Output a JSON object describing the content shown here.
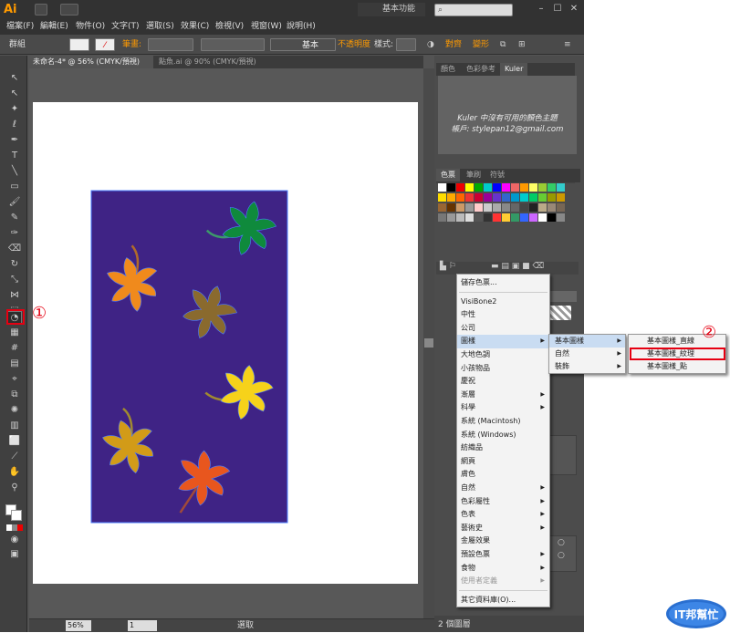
{
  "app": {
    "logo_text": "Ai",
    "workspace": "基本功能",
    "window_buttons": [
      "–",
      "☐",
      "✕"
    ]
  },
  "menubar": {
    "items": [
      "檔案(F)",
      "編輯(E)",
      "物件(O)",
      "文字(T)",
      "選取(S)",
      "效果(C)",
      "檢視(V)",
      "視窗(W)",
      "說明(H)"
    ]
  },
  "controlbar": {
    "selection_label": "群組",
    "stroke_label": "筆畫:",
    "stroke_style": "基本",
    "opacity_label": "不透明度",
    "style_label": "樣式:",
    "align_label": "對齊",
    "transform_label": "變形"
  },
  "doc_tabs": [
    {
      "label": "未命名-4* @ 56% (CMYK/預視)",
      "active": true
    },
    {
      "label": "點魚.ai @ 90% (CMYK/預視)",
      "active": false
    }
  ],
  "status": {
    "zoom": "56%",
    "page": "1",
    "mode": "選取"
  },
  "panels": {
    "top_tabs": [
      "顏色",
      "色彩參考",
      "Kuler"
    ],
    "kuler_message": "Kuler 中沒有可用的顏色主題",
    "kuler_account": "帳戶: stylepan12@gmail.com",
    "swatch_tabs": [
      "色票",
      "筆刷",
      "符號"
    ],
    "layers_label": "2 個圖層"
  },
  "context_menu": {
    "items": [
      {
        "label": "儲存色票...",
        "submenu": false,
        "highlight": false,
        "disabled": false
      },
      {
        "sep": true
      },
      {
        "label": "VisiBone2",
        "submenu": false,
        "highlight": false,
        "disabled": false
      },
      {
        "label": "中性",
        "submenu": false,
        "highlight": false,
        "disabled": false
      },
      {
        "label": "公司",
        "submenu": false,
        "highlight": false,
        "disabled": false
      },
      {
        "label": "圖樣",
        "submenu": true,
        "highlight": true,
        "disabled": false
      },
      {
        "label": "大地色調",
        "submenu": false,
        "highlight": false,
        "disabled": false
      },
      {
        "label": "小孩物品",
        "submenu": false,
        "highlight": false,
        "disabled": false
      },
      {
        "label": "慶祝",
        "submenu": false,
        "highlight": false,
        "disabled": false
      },
      {
        "label": "漸層",
        "submenu": true,
        "highlight": false,
        "disabled": false
      },
      {
        "label": "科學",
        "submenu": true,
        "highlight": false,
        "disabled": false
      },
      {
        "label": "系統 (Macintosh)",
        "submenu": false,
        "highlight": false,
        "disabled": false
      },
      {
        "label": "系統 (Windows)",
        "submenu": false,
        "highlight": false,
        "disabled": false
      },
      {
        "label": "紡織品",
        "submenu": false,
        "highlight": false,
        "disabled": false
      },
      {
        "label": "網頁",
        "submenu": false,
        "highlight": false,
        "disabled": false
      },
      {
        "label": "膚色",
        "submenu": false,
        "highlight": false,
        "disabled": false
      },
      {
        "label": "自然",
        "submenu": true,
        "highlight": false,
        "disabled": false
      },
      {
        "label": "色彩屬性",
        "submenu": true,
        "highlight": false,
        "disabled": false
      },
      {
        "label": "色表",
        "submenu": true,
        "highlight": false,
        "disabled": false
      },
      {
        "label": "藝術史",
        "submenu": true,
        "highlight": false,
        "disabled": false
      },
      {
        "label": "金屬效果",
        "submenu": false,
        "highlight": false,
        "disabled": false
      },
      {
        "label": "預設色票",
        "submenu": true,
        "highlight": false,
        "disabled": false
      },
      {
        "label": "食物",
        "submenu": true,
        "highlight": false,
        "disabled": false
      },
      {
        "label": "使用者定義",
        "submenu": true,
        "highlight": false,
        "disabled": true
      },
      {
        "sep": true
      },
      {
        "label": "其它資料庫(O)...",
        "submenu": false,
        "highlight": false,
        "disabled": false
      }
    ]
  },
  "submenu_pattern": {
    "items": [
      {
        "label": "基本圖樣",
        "submenu": true,
        "highlight": true
      },
      {
        "label": "自然",
        "submenu": true,
        "highlight": false
      },
      {
        "label": "裝飾",
        "submenu": true,
        "highlight": false
      }
    ]
  },
  "submenu_basic": {
    "items": [
      "基本圖樣_直線",
      "基本圖樣_紋理",
      "基本圖樣_點"
    ]
  },
  "annotations": {
    "step1": "①",
    "step2": "②"
  },
  "watermark": {
    "text": "IT邦幫忙"
  },
  "colors": {
    "artwork_bg": "#3f2385",
    "leaf_green": "#0f8a3c",
    "leaf_orange": "#f08a1c",
    "leaf_brown": "#8a6a2e",
    "leaf_yellow": "#f6d21a",
    "leaf_mustard": "#d29b18",
    "leaf_red": "#e8561e",
    "selection_blue": "#4a7cff",
    "annotation_red": "#e60012"
  }
}
